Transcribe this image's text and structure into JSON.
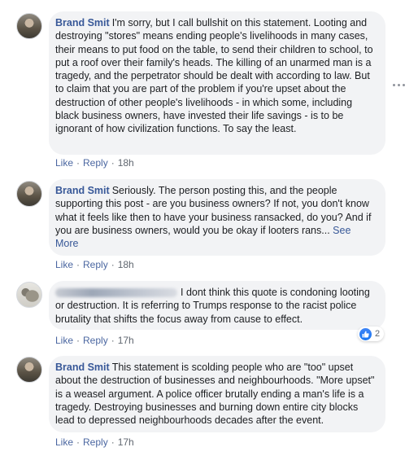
{
  "comments": [
    {
      "author": "Brand Smit",
      "text": "I'm sorry, but I call bullshit on this statement. Looting and destroying \"stores\" means ending people's livelihoods in many cases, their means to put food on the table, to send their children to school, to put a roof over their family's heads. The killing of an unarmed man is a tragedy, and the perpetrator should be dealt with according to law. But to claim that you are part of the problem if you're upset about the destruction of other people's livelihoods - in which some, including black business owners, have invested their life savings - is to be ignorant of how civilization functions. To say the least.",
      "like_label": "Like",
      "reply_label": "Reply",
      "time": "18h"
    },
    {
      "author": "Brand Smit",
      "text": "Seriously. The person posting this, and the people supporting this post - are you business owners? If not, you don't know what it feels like then to have your business ransacked, do you? And if you are business owners, would you be okay if looters rans...",
      "see_more": "See More",
      "like_label": "Like",
      "reply_label": "Reply",
      "time": "18h"
    },
    {
      "author": "",
      "text": "I dont think this quote is condoning looting or destruction. It is referring to Trumps response to the racist police brutality that shifts the focus away from cause to effect.",
      "like_label": "Like",
      "reply_label": "Reply",
      "time": "17h",
      "reaction_count": "2"
    },
    {
      "author": "Brand Smit",
      "text": "This statement is scolding people who are \"too\" upset about the destruction of businesses and neighbourhoods. \"More upset\" is a weasel argument. A police officer brutally ending a man's life is a tragedy. Destroying businesses and burning down entire city blocks lead to depressed neighbourhoods decades after the event.",
      "like_label": "Like",
      "reply_label": "Reply",
      "time": "17h"
    }
  ],
  "separator": "·",
  "colors": {
    "bubble": "#f2f3f5",
    "author": "#385898",
    "like_blue": "#1877f2"
  },
  "icons": [
    "more-options-icon",
    "like-reaction-icon"
  ]
}
